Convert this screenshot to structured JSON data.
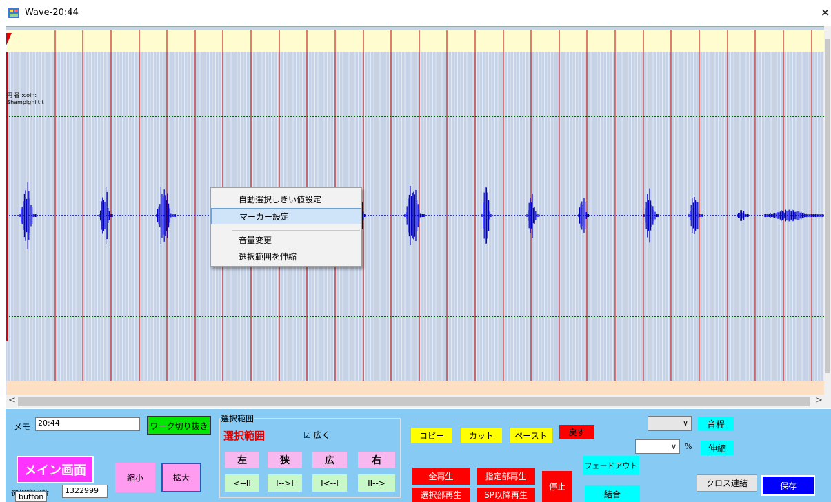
{
  "window": {
    "title": "Wave-20:44",
    "close_glyph": "✕"
  },
  "waveform": {
    "label_lines": [
      "円 番 :coin:",
      "Shampighiit t"
    ],
    "scroll_left": "<",
    "scroll_right": ">",
    "scroll_up": "^",
    "scroll_down": "v"
  },
  "context_menu": {
    "items": [
      "自動選択しきい値設定",
      "マーカー設定",
      "音量変更",
      "選択範囲を伸縮"
    ],
    "highlighted_index": 1
  },
  "panel": {
    "memo_label": "メモ",
    "memo_value": "20:44",
    "work_cut_btn": "ワーク切り抜き",
    "selection_group": "選択範囲",
    "selection_title": "選択範囲",
    "wide_check": "☑ 広く",
    "left_btn": "左",
    "narrow_btn": "狭",
    "wide_btn": "広",
    "right_btn": "右",
    "nav1": "<--II",
    "nav2": "I-->I",
    "nav3": "I<--I",
    "nav4": "II-->",
    "copy_btn": "コピー",
    "cut_btn": "カット",
    "paste_btn": "ペースト",
    "undo_btn": "戻す",
    "play_all": "全再生",
    "play_range": "指定部再生",
    "play_sel": "選択部再生",
    "play_sp": "SP以降再生",
    "stop_btn": "停止",
    "fadeout_btn": "フェードアウト",
    "join_btn": "結合",
    "pitch_btn": "音程",
    "stretch_btn": "伸縮",
    "percent_label": "%",
    "cross_btn": "クロス連結",
    "save_btn": "保存",
    "main_btn": "メイン画面",
    "shrink_btn": "縮小",
    "zoom_btn": "拡大",
    "sel_samples_label": "選択範囲数",
    "sel_samples_value": "1322999",
    "tooltip": "button",
    "dropdown_arrow": "∨"
  },
  "colors": {
    "panel_bg": "#87cbf5",
    "wave": "#0000c8",
    "marker": "#c00000",
    "threshold": "#006400"
  }
}
